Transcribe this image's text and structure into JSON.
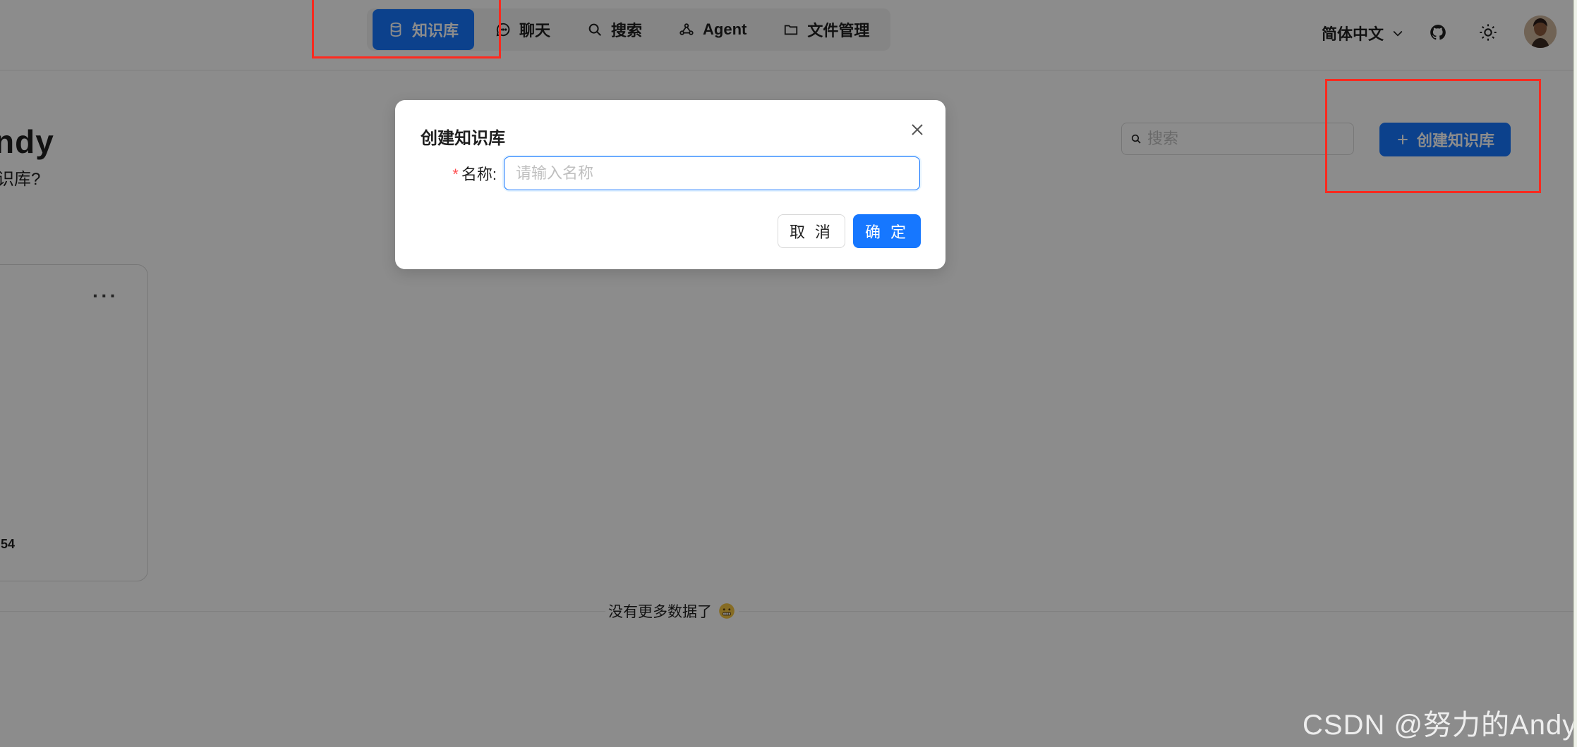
{
  "header": {
    "nav": [
      {
        "label": "知识库",
        "icon": "database-icon",
        "active": true
      },
      {
        "label": "聊天",
        "icon": "chat-bubble-icon",
        "active": false
      },
      {
        "label": "搜索",
        "icon": "search-icon",
        "active": false
      },
      {
        "label": "Agent",
        "icon": "share-nodes-icon",
        "active": false
      },
      {
        "label": "文件管理",
        "icon": "folder-icon",
        "active": false
      }
    ],
    "language": "简体中文",
    "icons": [
      "chevron-down-icon",
      "github-icon",
      "sun-icon",
      "avatar"
    ]
  },
  "main": {
    "greeting": "ndy",
    "subtitle": "识库?",
    "search_placeholder": "搜索",
    "create_button": "创建知识库",
    "card": {
      "more": "···",
      "meta": "54"
    },
    "no_more_text": "没有更多数据了"
  },
  "modal": {
    "title": "创建知识库",
    "name_label": "名称",
    "required_mark": "*",
    "name_placeholder": "请输入名称",
    "cancel": "取 消",
    "ok": "确 定"
  },
  "watermark": "CSDN @努力的Andy",
  "colors": {
    "primary": "#1677ff",
    "annotation": "#ff2a1f",
    "mask": "rgba(0,0,0,0.45)"
  }
}
